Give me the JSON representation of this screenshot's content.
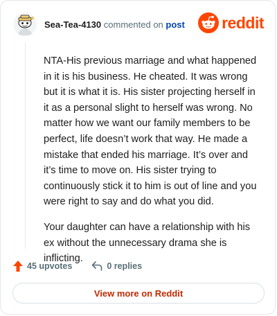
{
  "comment": {
    "username": "Sea-Tea-4130",
    "action_text": "commented on",
    "post_link": "post",
    "paragraphs": [
      "NTA-His previous marriage and what happened in it is his business. He cheated. It was wrong but it is what it is. His sister projecting herself in it as a personal slight to herself was wrong. No matter how we want our family members to be perfect, life doesn’t work that way. He made a mistake that ended his marriage. It’s over and it’s time to move on. His sister trying to continuously stick it to him is out of line and you were right to say and do what you did.",
      "Your daughter can have a relationship with his ex without the unnecessary drama she is inflicting."
    ]
  },
  "brand": {
    "name": "reddit",
    "color": "#ff4500"
  },
  "stats": {
    "upvotes": "45 upvotes",
    "replies": "0 replies"
  },
  "footer": {
    "view_more_label": "View more on Reddit"
  },
  "icons": {
    "avatar": "snoo-avatar",
    "brand": "reddit-logo-icon",
    "upvote": "upvote-arrow-icon",
    "reply": "reply-arrow-icon"
  }
}
